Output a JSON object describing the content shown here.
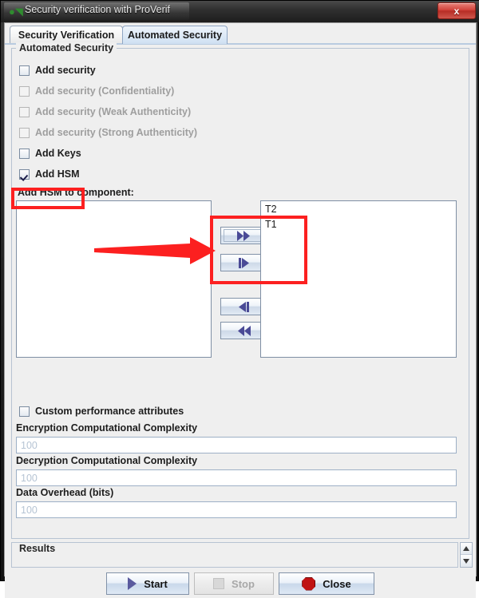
{
  "window": {
    "title": "Security verification with ProVerif",
    "app_icon": "turtle-icon",
    "close_label": "x"
  },
  "tabs": [
    {
      "label": "Security Verification",
      "selected": false
    },
    {
      "label": "Automated Security",
      "selected": true
    }
  ],
  "group_automated": {
    "legend": "Automated Security",
    "checkboxes": [
      {
        "label": "Add security",
        "checked": false,
        "disabled": false
      },
      {
        "label": "Add security (Confidentiality)",
        "checked": false,
        "disabled": true
      },
      {
        "label": "Add security (Weak Authenticity)",
        "checked": false,
        "disabled": true
      },
      {
        "label": "Add security (Strong Authenticity)",
        "checked": false,
        "disabled": true
      },
      {
        "label": "Add Keys",
        "checked": false,
        "disabled": false
      },
      {
        "label": "Add HSM",
        "checked": true,
        "disabled": false
      }
    ]
  },
  "transfer": {
    "caption": "Add HSM to component:",
    "left_items": [],
    "right_items": [
      "T2",
      "T1"
    ],
    "buttons": [
      {
        "icon": "double-right-arrow-icon",
        "glyph": "▶▶"
      },
      {
        "icon": "single-right-arrow-icon",
        "glyph": "▶"
      },
      {
        "icon": "single-left-arrow-icon",
        "glyph": "◀"
      },
      {
        "icon": "double-left-arrow-icon",
        "glyph": "◀◀"
      }
    ]
  },
  "performance": {
    "custom_checkbox": {
      "label": "Custom performance attributes",
      "checked": false
    },
    "fields": [
      {
        "label": "Encryption Computational Complexity",
        "value": "100"
      },
      {
        "label": "Decryption Computational Complexity",
        "value": "100"
      },
      {
        "label": "Data Overhead (bits)",
        "value": "100"
      }
    ]
  },
  "results": {
    "legend": "Results",
    "scroll_up": "▲",
    "scroll_down": "▼"
  },
  "actions": [
    {
      "label": "Start",
      "icon": "play-icon",
      "disabled": false
    },
    {
      "label": "Stop",
      "icon": "stop-square-icon",
      "disabled": true
    },
    {
      "label": "Close",
      "icon": "stop-octagon-icon",
      "disabled": false
    }
  ],
  "annotations": {
    "accent_color": "#fc2020",
    "boxes": [
      "add-hsm-checkbox",
      "transfer-buttons-and-list"
    ],
    "arrow": "points-right-to-transfer-buttons"
  }
}
